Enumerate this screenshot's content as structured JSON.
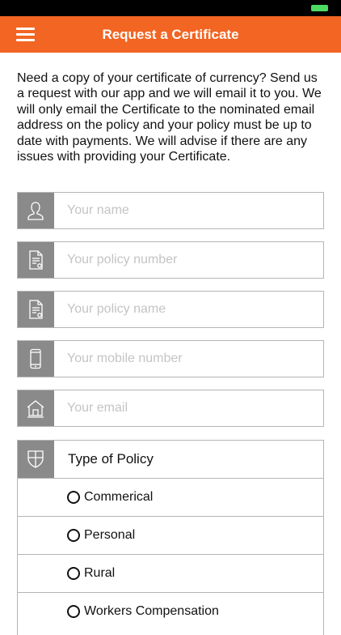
{
  "status_bar": {
    "battery_color": "#4cd964"
  },
  "nav": {
    "title": "Request a Certificate",
    "menu_icon": "hamburger-menu-icon",
    "color": "#f26522"
  },
  "intro": "Need a copy of your certificate of currency? Send us a request with our app and we will email it to you. We will only email the Certificate to the nominated email address on the policy and your policy must be up to date with payments. We will advise if there are any issues with providing your Certificate.",
  "form": {
    "name": {
      "placeholder": "Your name",
      "icon": "person-icon"
    },
    "policy_number": {
      "placeholder": "Your policy number",
      "icon": "document-icon"
    },
    "policy_name": {
      "placeholder": "Your policy name",
      "icon": "document-icon"
    },
    "mobile": {
      "placeholder": "Your mobile number",
      "icon": "phone-icon"
    },
    "email": {
      "placeholder": "Your email",
      "icon": "house-icon"
    }
  },
  "policy_type": {
    "title": "Type of Policy",
    "icon": "shield-icon",
    "options": [
      "Commerical",
      "Personal",
      "Rural",
      "Workers Compensation"
    ]
  }
}
